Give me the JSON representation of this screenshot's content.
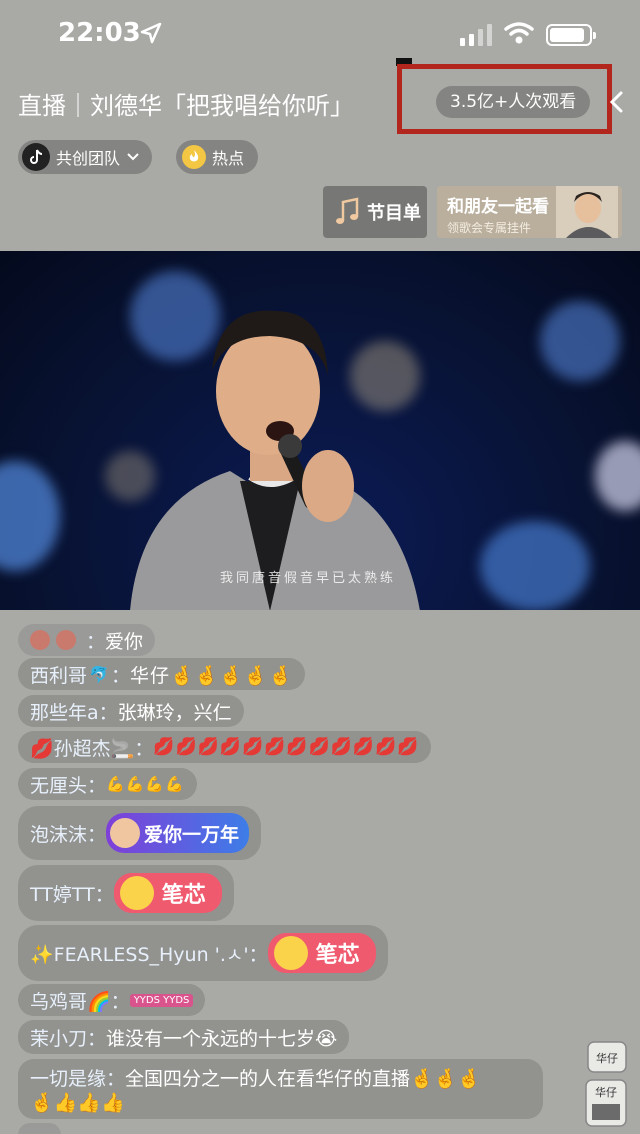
{
  "status": {
    "time": "22:03"
  },
  "header": {
    "title": "直播｜刘德华「把我唱给你听」",
    "viewers": "3.5亿+人次观看"
  },
  "tags": {
    "team": "共创团队",
    "hot": "热点"
  },
  "program": {
    "label": "节目单"
  },
  "watch_together": {
    "title": "和朋友一起看",
    "subtitle": "领歌会专属挂件"
  },
  "video": {
    "subtitle": "我同唐音假音早已太熟练"
  },
  "chat": [
    {
      "user": "",
      "text": "爱你"
    },
    {
      "user": "西利哥",
      "text": "华仔🤞🤞🤞🤞🤞"
    },
    {
      "user": "那些年a",
      "text": "张琳玲，兴仁"
    },
    {
      "user": "💋孙超杰🚬",
      "text": "💋💋💋💋💋💋💋💋💋💋💋💋"
    },
    {
      "user": "无厘头",
      "text": "💪💪💪💪"
    },
    {
      "user": "泡沫沫",
      "sticker": "爱你一万年"
    },
    {
      "user": "TT婷TT",
      "sticker": "笔芯"
    },
    {
      "user": "✨FEARLESS_Hyun '.ㅅ'",
      "sticker": "笔芯"
    },
    {
      "user": "乌鸡哥🌈",
      "text": "YYDS YYDS"
    },
    {
      "user": "茉小刀",
      "text": "谁没有一个永远的十七岁😭"
    },
    {
      "user": "一切是缘",
      "text": "全国四分之一的人在看华仔的直播🤞🤞🤞",
      "text2": "🤞👍👍👍"
    }
  ],
  "mini_card": {
    "label1": "华仔",
    "label2": "华仔"
  },
  "colors": {
    "highlight": "#b3261e",
    "background": "#a9a9a6"
  }
}
